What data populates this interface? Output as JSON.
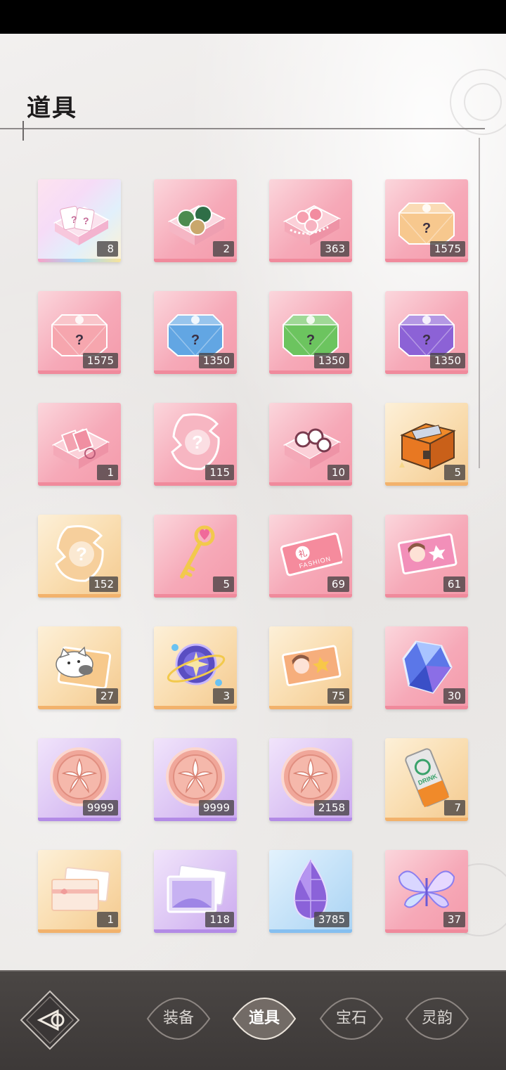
{
  "header": {
    "title": "道具"
  },
  "items": [
    {
      "name": "rainbow-card-box",
      "count": "8",
      "bg": "rainbow",
      "icon": "card-box-icon"
    },
    {
      "name": "badge-box",
      "count": "2",
      "bg": "pink",
      "icon": "badge-box-icon"
    },
    {
      "name": "accessory-box",
      "count": "363",
      "bg": "pink",
      "icon": "accessory-box-icon"
    },
    {
      "name": "orange-mystery-chest",
      "count": "1575",
      "bg": "pink",
      "icon": "mystery-chest-icon",
      "color": "#f7c88e"
    },
    {
      "name": "pink-mystery-chest",
      "count": "1575",
      "bg": "pink",
      "icon": "mystery-chest-icon",
      "color": "#f6a6ae"
    },
    {
      "name": "blue-mystery-chest",
      "count": "1350",
      "bg": "pink",
      "icon": "mystery-chest-icon",
      "color": "#62a6e3"
    },
    {
      "name": "green-mystery-chest",
      "count": "1350",
      "bg": "pink",
      "icon": "mystery-chest-icon",
      "color": "#6cc45f"
    },
    {
      "name": "purple-mystery-chest",
      "count": "1350",
      "bg": "pink",
      "icon": "mystery-chest-icon",
      "color": "#8c62d6"
    },
    {
      "name": "ticket-box",
      "count": "1",
      "bg": "pink",
      "icon": "ticket-box-icon"
    },
    {
      "name": "pink-mystery-fragment",
      "count": "115",
      "bg": "pink",
      "icon": "mystery-fragment-icon",
      "color": "#f7b6c2"
    },
    {
      "name": "photo-box",
      "count": "10",
      "bg": "pink",
      "icon": "photo-box-icon"
    },
    {
      "name": "treasure-chest",
      "count": "5",
      "bg": "orange",
      "icon": "treasure-chest-icon"
    },
    {
      "name": "gold-mystery-fragment",
      "count": "152",
      "bg": "orange",
      "icon": "mystery-fragment-icon",
      "color": "#f6cf9c"
    },
    {
      "name": "heart-key",
      "count": "5",
      "bg": "pink",
      "icon": "heart-key-icon"
    },
    {
      "name": "fashion-ticket",
      "count": "69",
      "bg": "pink",
      "icon": "fashion-ticket-icon",
      "text": "FASHION",
      "stamp": "礼"
    },
    {
      "name": "portrait-card",
      "count": "61",
      "bg": "pink",
      "icon": "portrait-card-icon"
    },
    {
      "name": "cat-card",
      "count": "27",
      "bg": "orange",
      "icon": "cat-card-icon"
    },
    {
      "name": "star-orb",
      "count": "3",
      "bg": "orange",
      "icon": "star-orb-icon"
    },
    {
      "name": "portrait-card-gold",
      "count": "75",
      "bg": "orange",
      "icon": "portrait-card-icon"
    },
    {
      "name": "blue-crystal",
      "count": "30",
      "bg": "pink",
      "icon": "crystal-icon"
    },
    {
      "name": "flower-coin-1",
      "count": "9999",
      "bg": "purple",
      "icon": "flower-coin-icon"
    },
    {
      "name": "flower-coin-2",
      "count": "9999",
      "bg": "purple",
      "icon": "flower-coin-icon"
    },
    {
      "name": "flower-coin-3",
      "count": "2158",
      "bg": "purple",
      "icon": "flower-coin-icon"
    },
    {
      "name": "drink-can",
      "count": "7",
      "bg": "orange",
      "icon": "drink-can-icon",
      "text": "DRINK"
    },
    {
      "name": "gift-card",
      "count": "1",
      "bg": "orange",
      "icon": "gift-card-icon"
    },
    {
      "name": "postcard",
      "count": "118",
      "bg": "purple",
      "icon": "postcard-icon"
    },
    {
      "name": "amethyst-drop",
      "count": "3785",
      "bg": "blue",
      "icon": "amethyst-drop-icon"
    },
    {
      "name": "crystal-butterfly",
      "count": "37",
      "bg": "pink",
      "icon": "butterfly-icon"
    }
  ],
  "nav": {
    "back_icon": "back-arrow-icon",
    "tabs": [
      {
        "label": "装备",
        "active": false
      },
      {
        "label": "道具",
        "active": true
      },
      {
        "label": "宝石",
        "active": false
      },
      {
        "label": "灵韵",
        "active": false
      }
    ]
  }
}
